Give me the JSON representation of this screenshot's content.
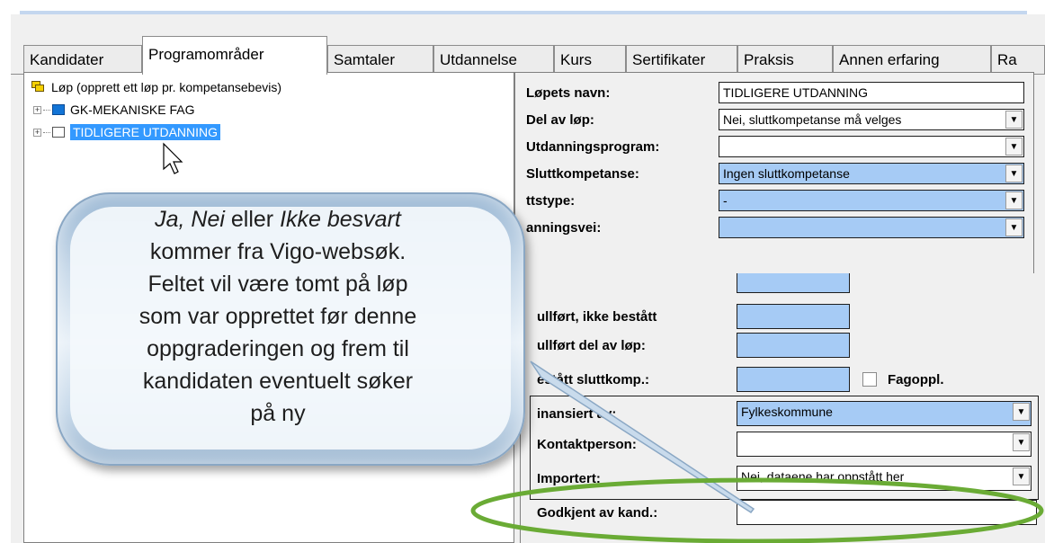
{
  "tabs": [
    "Kandidater",
    "Programområder",
    "Samtaler",
    "Utdannelse",
    "Kurs",
    "Sertifikater",
    "Praksis",
    "Annen erfaring",
    "Ra"
  ],
  "active_tab": "Programområder",
  "tree": {
    "root_label": "Løp (opprett ett løp pr. kompetansebevis)",
    "items": [
      {
        "label": "GK-MEKANISKE FAG",
        "icon": "folder-blue-icon"
      },
      {
        "label": "TIDLIGERE UTDANNING",
        "icon": "folder-icon",
        "selected": true
      }
    ]
  },
  "form": {
    "lopets_navn": {
      "label": "Løpets navn:",
      "value": "TIDLIGERE UTDANNING"
    },
    "del_av_lop": {
      "label": "Del av løp:",
      "value": "Nei, sluttkompetanse må velges"
    },
    "utdanningsprogram": {
      "label": "Utdanningsprogram:",
      "value": ""
    },
    "sluttkompetanse": {
      "label": "Sluttkompetanse:",
      "value": "Ingen sluttkompetanse"
    },
    "lopstype": {
      "label": "Løpstype:",
      "visible": "ttstype:",
      "value": "-"
    },
    "utdanningsvei": {
      "label": "Utdanningsvei:",
      "visible": "anningsvei:",
      "value": ""
    }
  },
  "panel": {
    "fullfort_ikke_bestatt": {
      "label": "ullført, ikke bestått"
    },
    "fullfort_del": {
      "label": "ullført del av løp:"
    },
    "bestatt_sluttkomp": {
      "label": "estått sluttkomp.:"
    },
    "fagoppl": {
      "label": "Fagoppl."
    },
    "finansiert": {
      "label": "inansiert av:",
      "value": "Fylkeskommune"
    },
    "kontaktperson": {
      "label": "Kontaktperson:",
      "value": ""
    },
    "importert": {
      "label": "Importert:",
      "value": "Nei, dataene har oppstått her"
    },
    "godkjent": {
      "label": "Godkjent av kand.:",
      "value": ""
    }
  },
  "callout": {
    "line1_italic_a": "Ja, Nei",
    "line1_plain": " eller ",
    "line1_italic_b": "Ikke besvart",
    "rest": [
      "kommer fra Vigo-websøk.",
      "Feltet vil være tomt på løp",
      "som var opprettet før denne",
      "oppgraderingen og frem til",
      "kandidaten eventuelt søker",
      "på ny"
    ]
  },
  "colors": {
    "highlight_ellipse": "#6aab35",
    "selection": "#3399ff",
    "blue_field": "#a6cbf5"
  }
}
